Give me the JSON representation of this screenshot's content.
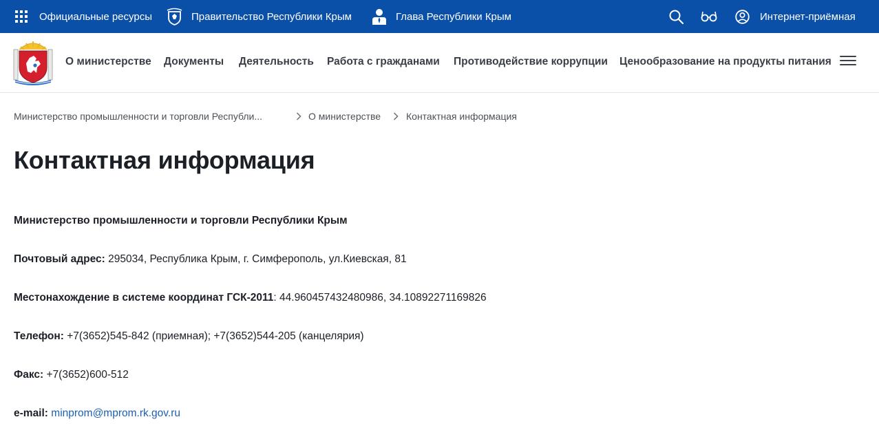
{
  "topbar": {
    "resources_label": "Официальные ресурсы",
    "government_label": "Правительство Республики Крым",
    "head_label": "Глава Республики Крым",
    "reception_label": "Интернет-приёмная",
    "icons": [
      "grid-icon",
      "coat-of-arms-icon",
      "person-icon",
      "search-icon",
      "glasses-icon",
      "user-circle-icon"
    ]
  },
  "nav": {
    "items": [
      {
        "label": "О министерстве"
      },
      {
        "label": "Документы"
      },
      {
        "label": "Деятельность"
      },
      {
        "label": "Работа с гражданами"
      },
      {
        "label": "Противодействие коррупции"
      },
      {
        "label": "Ценообразование на продукты питания"
      }
    ]
  },
  "breadcrumb": {
    "items": [
      "Министерство промышленности и торговли Республи...",
      "О министерстве",
      "Контактная информация"
    ]
  },
  "page": {
    "title": "Контактная информация",
    "org_name": "Министерство промышленности и торговли Республики Крым",
    "postal_label": "Почтовый адрес:",
    "postal_value": " 295034, Республика Крым, г. Симферополь, ул.Киевская, 81",
    "coords_label": "Местонахождение в системе координат ГСК-2011",
    "coords_value": ": 44.960457432480986, 34.10892271169826",
    "phone_label": "Телефон:",
    "phone_value": " +7(3652)545-842 (приемная); +7(3652)544-205 (канцелярия)",
    "fax_label": "Факс:",
    "fax_value": " +7(3652)600-512",
    "email_label": "e-mail:",
    "email_value": "minprom@mprom.rk.gov.ru"
  },
  "colors": {
    "topbar_bg": "#0a4fa8",
    "link": "#1a5fb4",
    "text": "#1b1f26"
  }
}
